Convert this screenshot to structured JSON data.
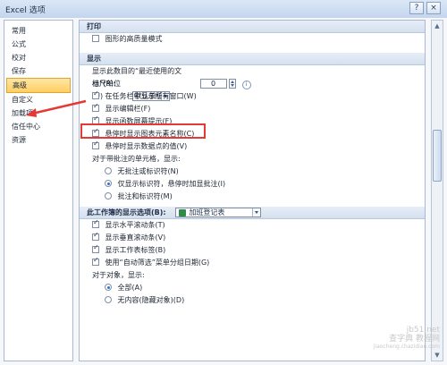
{
  "window": {
    "title": "Excel 选项"
  },
  "titlebar": {
    "help": "?",
    "close": "×"
  },
  "sidebar": {
    "items": [
      "常用",
      "公式",
      "校对",
      "保存",
      "高级",
      "自定义",
      "加载项",
      "信任中心",
      "资源"
    ],
    "active_index": 4
  },
  "sections": {
    "print": "打印",
    "display": "显示",
    "workbook_display": "此工作簿的显示选项(B):"
  },
  "print": {
    "high_quality": "图形的高质量模式"
  },
  "display": {
    "recent_docs_label": "显示此数目的“最近使用的文档”(R):",
    "recent_docs_value": "0",
    "ruler_units_label": "标尺单位(U)",
    "ruler_units_value": "默认单位",
    "show_all_windows_taskbar": "在任务栏中显示所有窗口(W)",
    "show_formula_bar": "显示编辑栏(F)",
    "show_function_tips": "显示函数屏幕提示(F)",
    "show_chart_element_names": "悬停时显示图表元素名称(C)",
    "show_datapoint_values": "悬停时显示数据点的值(V)",
    "comments_label": "对于带批注的单元格，显示:",
    "comments_none": "无批注或标识符(N)",
    "comments_indicator_only": "仅显示标识符，悬停时加显批注(I)",
    "comments_and_indicators": "批注和标识符(M)"
  },
  "workbook": {
    "selected_workbook": "加班登记表",
    "show_horizontal_scroll": "显示水平滚动条(T)",
    "show_vertical_scroll": "显示垂直滚动条(V)",
    "show_sheet_tabs": "显示工作表标签(B)",
    "group_dates_autofilter": "使用“自动筛选”菜单分组日期(G)",
    "objects_label": "对于对象，显示:",
    "objects_all": "全部(A)",
    "objects_none": "无内容(隐藏对象)(D)"
  },
  "watermark": {
    "line1": "jb51.net",
    "line2": "查字典 教程网",
    "line3": "jiaocheng.chazidian.com"
  }
}
